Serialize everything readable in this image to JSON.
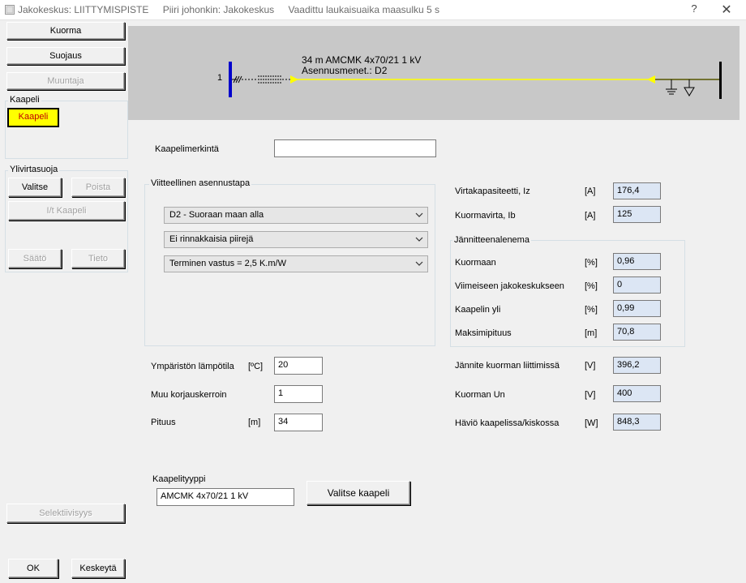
{
  "window": {
    "title": "Jakokeskus: LIITTYMISPISTE",
    "subtitle_circuit": "Piiri johonkin: Jakokeskus",
    "subtitle_time": "Vaadittu laukaisuaika maasulku 5 s",
    "help": "?",
    "close": "✕"
  },
  "left": {
    "kuorma": "Kuorma",
    "suojaus": "Suojaus",
    "muuntaja": "Muuntaja",
    "kaapeli_group": "Kaapeli",
    "kaapeli_button": "Kaapeli",
    "ylivirta_group": "Ylivirtasuoja",
    "valitse": "Valitse",
    "poista": "Poista",
    "it_kaapeli": "I/t Kaapeli",
    "saato": "Säätö",
    "tieto": "Tieto",
    "selektiivisyys": "Selektiivisyys",
    "ok": "OK",
    "keskeyta": "Keskeytä"
  },
  "diagram": {
    "node_number": "1",
    "cable_line1": "34 m  AMCMK 4x70/21 1 kV",
    "cable_line2": "Asennusmenet.: D2",
    "line_color": "#ffff00",
    "bus_color": "#0000cc"
  },
  "form": {
    "kaapelimerkinta_label": "Kaapelimerkintä",
    "kaapelimerkinta_value": "",
    "viite_group": "Viitteellinen asennustapa",
    "select1": "D2 - Suoraan maan alla",
    "select2": "Ei rinnakkaisia piirejä",
    "select3": "Terminen vastus = 2,5 K.m/W",
    "ymparisto_label": "Ympäristön lämpötila",
    "ymparisto_unit": "[ºC]",
    "ymparisto_value": "20",
    "muu_label": "Muu korjauskerroin",
    "muu_value": "1",
    "pituus_label": "Pituus",
    "pituus_unit": "[m]",
    "pituus_value": "34",
    "kaapelityyppi_group": "Kaapelityyppi",
    "kaapelityyppi_value": "AMCMK 4x70/21 1 kV",
    "valitse_kaapeli": "Valitse kaapeli"
  },
  "results": {
    "iz_label": "Virtakapasiteetti, Iz",
    "iz_unit": "[A]",
    "iz_value": "176,4",
    "ib_label": "Kuormavirta, Ib",
    "ib_unit": "[A]",
    "ib_value": "125",
    "jannite_group": "Jännitteenalenema",
    "kuormaan_label": "Kuormaan",
    "kuormaan_unit": "[%]",
    "kuormaan_value": "0,96",
    "viimeiseen_label": "Viimeiseen jakokeskukseen",
    "viimeiseen_unit": "[%]",
    "viimeiseen_value": "0",
    "yli_label": "Kaapelin yli",
    "yli_unit": "[%]",
    "yli_value": "0,99",
    "maksimi_label": "Maksimipituus",
    "maksimi_unit": "[m]",
    "maksimi_value": "70,8",
    "liitin_label": "Jännite kuorman liittimissä",
    "liitin_unit": "[V]",
    "liitin_value": "396,2",
    "un_label": "Kuorman Un",
    "un_unit": "[V]",
    "un_value": "400",
    "havio_label": "Häviö kaapelissa/kiskossa",
    "havio_unit": "[W]",
    "havio_value": "848,3"
  }
}
